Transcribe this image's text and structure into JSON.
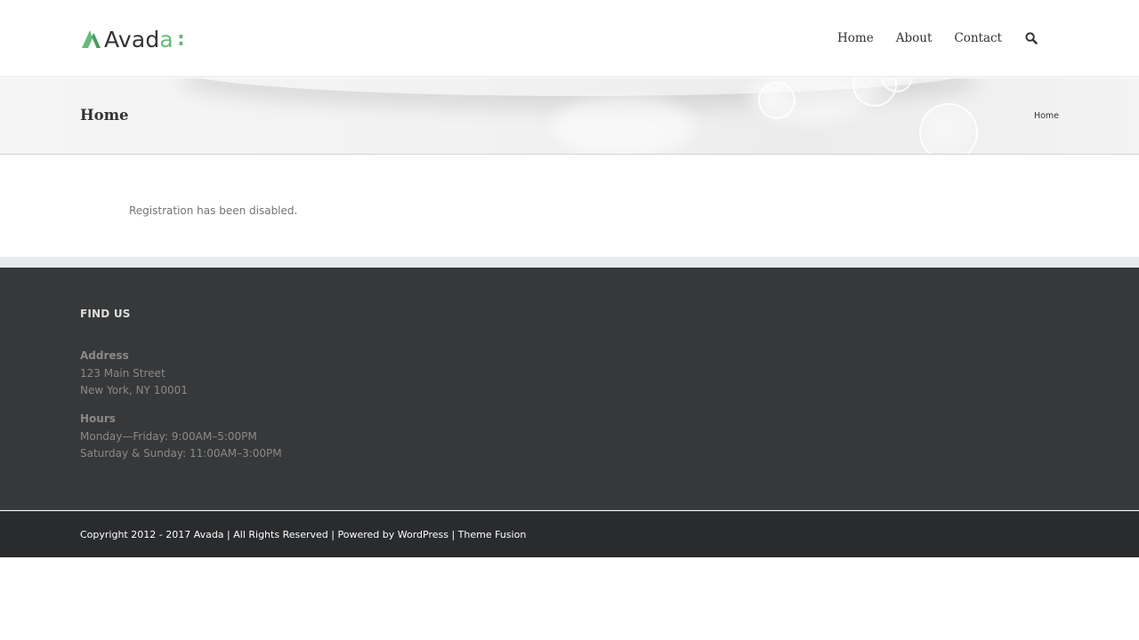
{
  "header": {
    "logo": {
      "text_main": "Avad",
      "text_accent": "a",
      "colon": ":",
      "icon": "avada-logo-icon"
    },
    "nav": [
      {
        "label": "Home"
      },
      {
        "label": "About"
      },
      {
        "label": "Contact"
      }
    ],
    "search_icon": "search-icon"
  },
  "titlebar": {
    "title": "Home",
    "breadcrumb": "Home"
  },
  "main": {
    "message": "Registration has been disabled."
  },
  "footer": {
    "heading": "FIND US",
    "address": {
      "label": "Address",
      "line1": "123 Main Street",
      "line2": "New York, NY 10001"
    },
    "hours": {
      "label": "Hours",
      "line1": "Monday—Friday: 9:00AM–5:00PM",
      "line2": "Saturday & Sunday: 11:00AM–3:00PM"
    }
  },
  "copyright": {
    "prefix": "Copyright 2012 - 2017 Avada | All Rights Reserved | Powered by ",
    "link1": "WordPress",
    "sep": " | ",
    "link2": "Theme Fusion"
  },
  "colors": {
    "accent": "#65bc7b",
    "footer_bg": "#363839",
    "copyright_bg": "#2a2b2d"
  }
}
